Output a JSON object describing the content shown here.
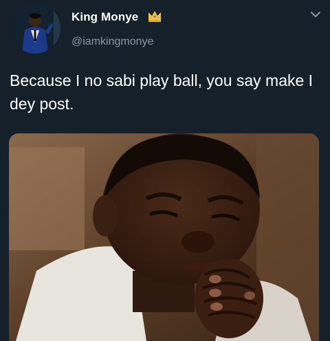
{
  "author": {
    "display_name": "King Monye",
    "handle": "@iamkingmonye",
    "badge_icon": "crown-icon",
    "avatar_icon": "avatar-photo"
  },
  "tweet": {
    "text": "Because I no sabi play ball, you say make I dey post.",
    "menu_icon": "chevron-down-icon"
  },
  "media": {
    "kind": "photo",
    "subject_icon": "crying-child-praying-photo"
  },
  "colors": {
    "background": "#15202b",
    "text_primary": "#ffffff",
    "text_secondary": "#8899a6",
    "badge": "#f5c542"
  }
}
